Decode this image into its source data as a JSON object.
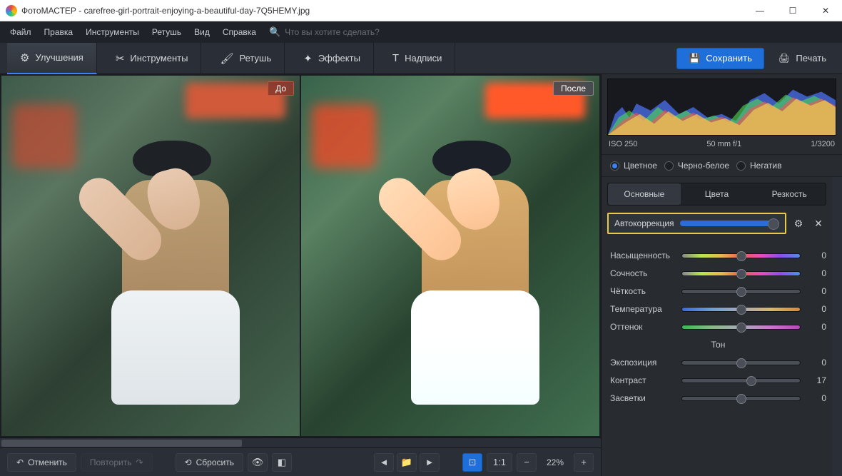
{
  "title": "ФотоМАСТЕР - carefree-girl-portrait-enjoying-a-beautiful-day-7Q5HEMY.jpg",
  "menu": [
    "Файл",
    "Правка",
    "Инструменты",
    "Ретушь",
    "Вид",
    "Справка"
  ],
  "searchPlaceholder": "Что вы хотите сделать?",
  "tabs": {
    "enhance": "Улучшения",
    "tools": "Инструменты",
    "retouch": "Ретушь",
    "effects": "Эффекты",
    "text": "Надписи"
  },
  "save": "Сохранить",
  "print": "Печать",
  "compare": {
    "before": "До",
    "after": "После"
  },
  "bottom": {
    "undo": "Отменить",
    "redo": "Повторить",
    "reset": "Сбросить",
    "ratio": "1:1",
    "zoom": "22%"
  },
  "meta": {
    "iso": "ISO 250",
    "lens": "50 mm f/1",
    "shutter": "1/3200"
  },
  "colorModes": {
    "color": "Цветное",
    "bw": "Черно-белое",
    "neg": "Негатив"
  },
  "subtabs": {
    "basic": "Основные",
    "colors": "Цвета",
    "sharp": "Резкость"
  },
  "auto": "Автокоррекция",
  "sliders": {
    "sat": {
      "label": "Насыщенность",
      "val": "0",
      "pos": 50,
      "cls": "rainbow"
    },
    "vib": {
      "label": "Сочность",
      "val": "0",
      "pos": 50,
      "cls": "rainbow"
    },
    "cla": {
      "label": "Чёткость",
      "val": "0",
      "pos": 50,
      "cls": "gray"
    },
    "tem": {
      "label": "Температура",
      "val": "0",
      "pos": 50,
      "cls": "temp"
    },
    "tin": {
      "label": "Оттенок",
      "val": "0",
      "pos": 50,
      "cls": "tint"
    }
  },
  "toneHeader": "Тон",
  "tone": {
    "exp": {
      "label": "Экспозиция",
      "val": "0",
      "pos": 50
    },
    "con": {
      "label": "Контраст",
      "val": "17",
      "pos": 59
    },
    "hig": {
      "label": "Засветки",
      "val": "0",
      "pos": 50
    }
  }
}
